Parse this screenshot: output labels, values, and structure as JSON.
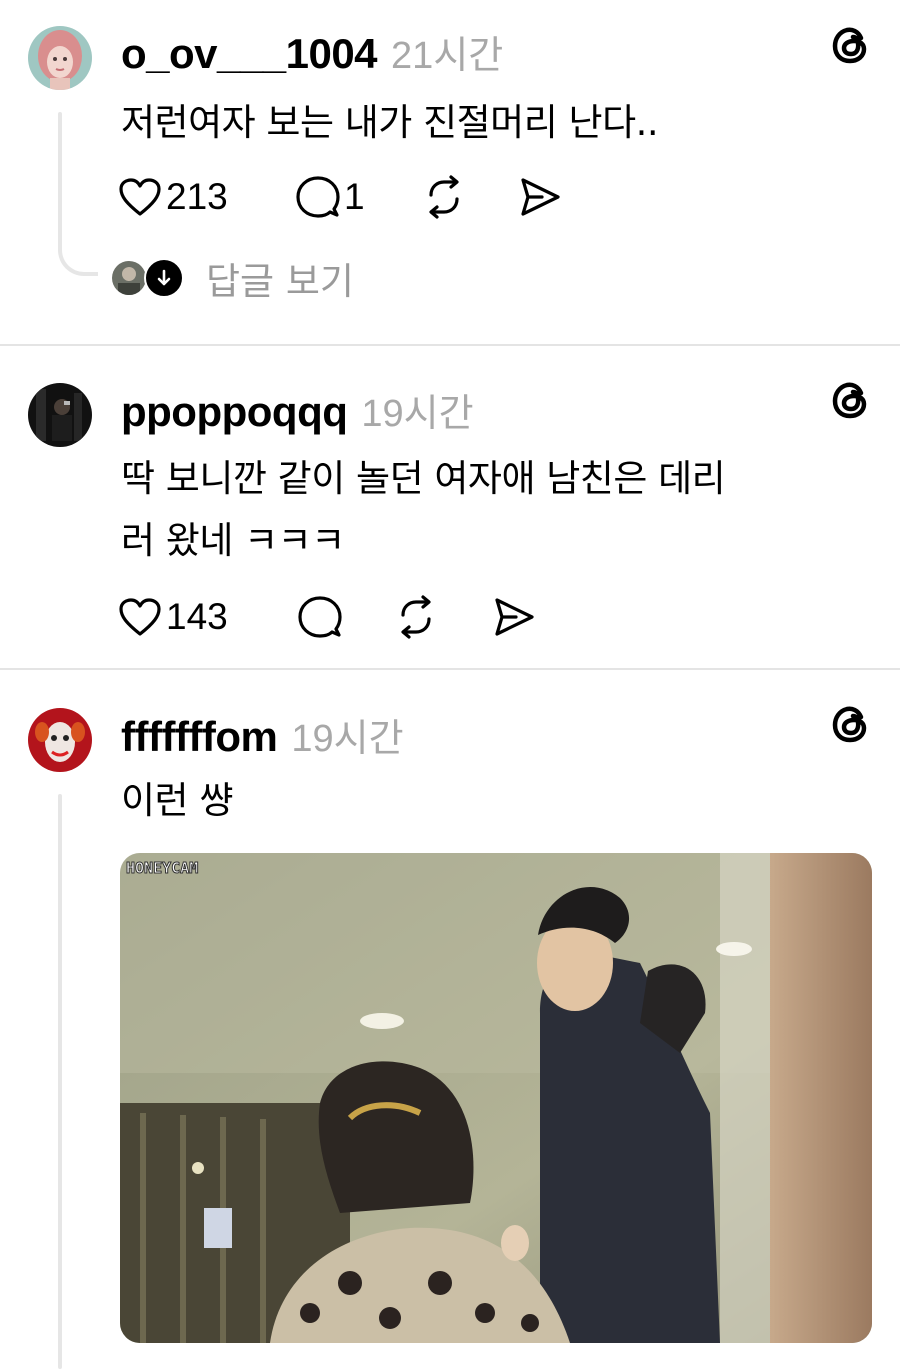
{
  "posts": [
    {
      "username": "o_ov___1004",
      "time": "21시간",
      "text": "저런여자 보는 내가 진절머리 난다..",
      "likes": "213",
      "comments": "1",
      "replies_label": "답글 보기",
      "icons": [
        "heart-icon",
        "comment-icon",
        "repost-icon",
        "share-icon",
        "threads-logo"
      ]
    },
    {
      "username": "ppoppoqqq",
      "time": "19시간",
      "text_line1": "딱 보니깐 같이 놀던 여자애 남친은 데리",
      "text_line2": "러 왔네 ㅋㅋㅋ",
      "likes": "143",
      "icons": [
        "heart-icon",
        "comment-icon",
        "repost-icon",
        "share-icon",
        "threads-logo"
      ]
    },
    {
      "username": "fffffffom",
      "time": "19시간",
      "text": "이런 썅",
      "media_watermark": "HONEYCAM",
      "icons": [
        "threads-logo"
      ]
    }
  ],
  "colors": {
    "background": "#ffffff",
    "text": "#000000",
    "secondary_text": "#a8a8a8",
    "divider": "#e4e4e4",
    "thread_line": "#e6e6e6"
  }
}
